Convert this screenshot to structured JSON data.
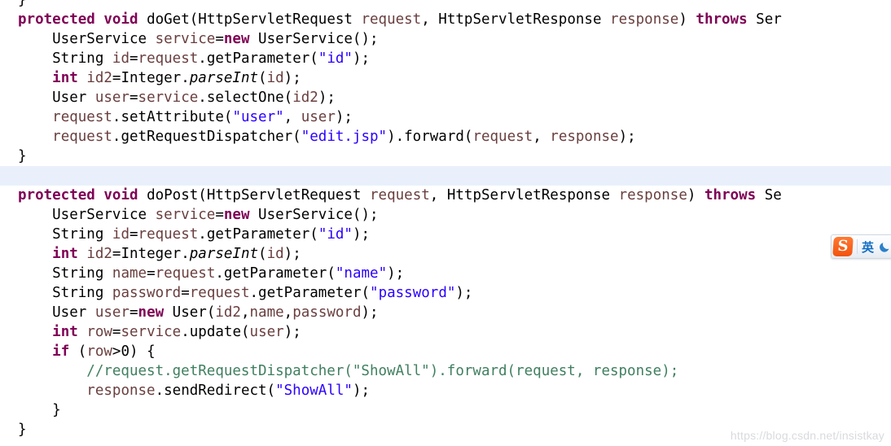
{
  "editor": {
    "language": "java",
    "background_color": "#ffffff",
    "highlight_line_color": "#e9f0fb",
    "colors": {
      "keyword": "#7f0055",
      "string": "#2a00ff",
      "comment": "#3f7f5f",
      "variable": "#6a3e3e",
      "plain": "#000000"
    },
    "lines": [
      {
        "index": 0,
        "highlighted": false,
        "tokens": [
          {
            "t": "}",
            "c": "plain",
            "indent": 4
          }
        ]
      },
      {
        "index": 1,
        "highlighted": false,
        "tokens": [
          {
            "t": "protected",
            "c": "keyword"
          },
          {
            "t": " ",
            "c": "plain"
          },
          {
            "t": "void",
            "c": "keyword"
          },
          {
            "t": " doGet(HttpServletRequest ",
            "c": "plain"
          },
          {
            "t": "request",
            "c": "var"
          },
          {
            "t": ", HttpServletResponse ",
            "c": "plain"
          },
          {
            "t": "response",
            "c": "var"
          },
          {
            "t": ") ",
            "c": "plain"
          },
          {
            "t": "throws",
            "c": "keyword"
          },
          {
            "t": " Ser",
            "c": "plain"
          }
        ]
      },
      {
        "index": 2,
        "highlighted": false,
        "tokens": [
          {
            "t": "    UserService ",
            "c": "plain"
          },
          {
            "t": "service",
            "c": "var"
          },
          {
            "t": "=",
            "c": "plain"
          },
          {
            "t": "new",
            "c": "keyword"
          },
          {
            "t": " UserService();",
            "c": "plain"
          }
        ]
      },
      {
        "index": 3,
        "highlighted": false,
        "tokens": [
          {
            "t": "    String ",
            "c": "plain"
          },
          {
            "t": "id",
            "c": "var"
          },
          {
            "t": "=",
            "c": "plain"
          },
          {
            "t": "request",
            "c": "var"
          },
          {
            "t": ".getParameter(",
            "c": "plain"
          },
          {
            "t": "\"id\"",
            "c": "string"
          },
          {
            "t": ");",
            "c": "plain"
          }
        ]
      },
      {
        "index": 4,
        "highlighted": false,
        "tokens": [
          {
            "t": "    ",
            "c": "plain"
          },
          {
            "t": "int",
            "c": "keyword"
          },
          {
            "t": " ",
            "c": "plain"
          },
          {
            "t": "id2",
            "c": "var"
          },
          {
            "t": "=Integer.",
            "c": "plain"
          },
          {
            "t": "parseInt",
            "c": "static"
          },
          {
            "t": "(",
            "c": "plain"
          },
          {
            "t": "id",
            "c": "var"
          },
          {
            "t": ");",
            "c": "plain"
          }
        ]
      },
      {
        "index": 5,
        "highlighted": false,
        "tokens": [
          {
            "t": "    User ",
            "c": "plain"
          },
          {
            "t": "user",
            "c": "var"
          },
          {
            "t": "=",
            "c": "plain"
          },
          {
            "t": "service",
            "c": "var"
          },
          {
            "t": ".selectOne(",
            "c": "plain"
          },
          {
            "t": "id2",
            "c": "var"
          },
          {
            "t": ");",
            "c": "plain"
          }
        ]
      },
      {
        "index": 6,
        "highlighted": false,
        "tokens": [
          {
            "t": "    ",
            "c": "plain"
          },
          {
            "t": "request",
            "c": "var"
          },
          {
            "t": ".setAttribute(",
            "c": "plain"
          },
          {
            "t": "\"user\"",
            "c": "string"
          },
          {
            "t": ", ",
            "c": "plain"
          },
          {
            "t": "user",
            "c": "var"
          },
          {
            "t": ");",
            "c": "plain"
          }
        ]
      },
      {
        "index": 7,
        "highlighted": false,
        "tokens": [
          {
            "t": "    ",
            "c": "plain"
          },
          {
            "t": "request",
            "c": "var"
          },
          {
            "t": ".getRequestDispatcher(",
            "c": "plain"
          },
          {
            "t": "\"edit.jsp\"",
            "c": "string"
          },
          {
            "t": ").forward(",
            "c": "plain"
          },
          {
            "t": "request",
            "c": "var"
          },
          {
            "t": ", ",
            "c": "plain"
          },
          {
            "t": "response",
            "c": "var"
          },
          {
            "t": ");",
            "c": "plain"
          }
        ]
      },
      {
        "index": 8,
        "highlighted": false,
        "tokens": [
          {
            "t": "}",
            "c": "plain",
            "indent": 2
          }
        ]
      },
      {
        "index": 9,
        "highlighted": true,
        "tokens": []
      },
      {
        "index": 10,
        "highlighted": false,
        "tokens": [
          {
            "t": "protected",
            "c": "keyword"
          },
          {
            "t": " ",
            "c": "plain"
          },
          {
            "t": "void",
            "c": "keyword"
          },
          {
            "t": " doPost(HttpServletRequest ",
            "c": "plain"
          },
          {
            "t": "request",
            "c": "var"
          },
          {
            "t": ", HttpServletResponse ",
            "c": "plain"
          },
          {
            "t": "response",
            "c": "var"
          },
          {
            "t": ") ",
            "c": "plain"
          },
          {
            "t": "throws",
            "c": "keyword"
          },
          {
            "t": " Se",
            "c": "plain"
          }
        ]
      },
      {
        "index": 11,
        "highlighted": false,
        "tokens": [
          {
            "t": "    UserService ",
            "c": "plain"
          },
          {
            "t": "service",
            "c": "var"
          },
          {
            "t": "=",
            "c": "plain"
          },
          {
            "t": "new",
            "c": "keyword"
          },
          {
            "t": " UserService();",
            "c": "plain"
          }
        ]
      },
      {
        "index": 12,
        "highlighted": false,
        "tokens": [
          {
            "t": "    String ",
            "c": "plain"
          },
          {
            "t": "id",
            "c": "var"
          },
          {
            "t": "=",
            "c": "plain"
          },
          {
            "t": "request",
            "c": "var"
          },
          {
            "t": ".getParameter(",
            "c": "plain"
          },
          {
            "t": "\"id\"",
            "c": "string"
          },
          {
            "t": ");",
            "c": "plain"
          }
        ]
      },
      {
        "index": 13,
        "highlighted": false,
        "tokens": [
          {
            "t": "    ",
            "c": "plain"
          },
          {
            "t": "int",
            "c": "keyword"
          },
          {
            "t": " ",
            "c": "plain"
          },
          {
            "t": "id2",
            "c": "var"
          },
          {
            "t": "=Integer.",
            "c": "plain"
          },
          {
            "t": "parseInt",
            "c": "static"
          },
          {
            "t": "(",
            "c": "plain"
          },
          {
            "t": "id",
            "c": "var"
          },
          {
            "t": ");",
            "c": "plain"
          }
        ]
      },
      {
        "index": 14,
        "highlighted": false,
        "tokens": [
          {
            "t": "    String ",
            "c": "plain"
          },
          {
            "t": "name",
            "c": "var"
          },
          {
            "t": "=",
            "c": "plain"
          },
          {
            "t": "request",
            "c": "var"
          },
          {
            "t": ".getParameter(",
            "c": "plain"
          },
          {
            "t": "\"name\"",
            "c": "string"
          },
          {
            "t": ");",
            "c": "plain"
          }
        ]
      },
      {
        "index": 15,
        "highlighted": false,
        "tokens": [
          {
            "t": "    String ",
            "c": "plain"
          },
          {
            "t": "password",
            "c": "var"
          },
          {
            "t": "=",
            "c": "plain"
          },
          {
            "t": "request",
            "c": "var"
          },
          {
            "t": ".getParameter(",
            "c": "plain"
          },
          {
            "t": "\"password\"",
            "c": "string"
          },
          {
            "t": ");",
            "c": "plain"
          }
        ]
      },
      {
        "index": 16,
        "highlighted": false,
        "tokens": [
          {
            "t": "    User ",
            "c": "plain"
          },
          {
            "t": "user",
            "c": "var"
          },
          {
            "t": "=",
            "c": "plain"
          },
          {
            "t": "new",
            "c": "keyword"
          },
          {
            "t": " User(",
            "c": "plain"
          },
          {
            "t": "id2",
            "c": "var"
          },
          {
            "t": ",",
            "c": "plain"
          },
          {
            "t": "name",
            "c": "var"
          },
          {
            "t": ",",
            "c": "plain"
          },
          {
            "t": "password",
            "c": "var"
          },
          {
            "t": ");",
            "c": "plain"
          }
        ]
      },
      {
        "index": 17,
        "highlighted": false,
        "tokens": [
          {
            "t": "    ",
            "c": "plain"
          },
          {
            "t": "int",
            "c": "keyword"
          },
          {
            "t": " ",
            "c": "plain"
          },
          {
            "t": "row",
            "c": "var"
          },
          {
            "t": "=",
            "c": "plain"
          },
          {
            "t": "service",
            "c": "var"
          },
          {
            "t": ".update(",
            "c": "plain"
          },
          {
            "t": "user",
            "c": "var"
          },
          {
            "t": ");",
            "c": "plain"
          }
        ]
      },
      {
        "index": 18,
        "highlighted": false,
        "tokens": [
          {
            "t": "    ",
            "c": "plain"
          },
          {
            "t": "if",
            "c": "keyword"
          },
          {
            "t": " (",
            "c": "plain"
          },
          {
            "t": "row",
            "c": "var"
          },
          {
            "t": ">0) {",
            "c": "plain"
          }
        ]
      },
      {
        "index": 19,
        "highlighted": false,
        "tokens": [
          {
            "t": "        //request.getRequestDispatcher(\"ShowAll\").forward(request, response);",
            "c": "comment"
          }
        ]
      },
      {
        "index": 20,
        "highlighted": false,
        "tokens": [
          {
            "t": "        ",
            "c": "plain"
          },
          {
            "t": "response",
            "c": "var"
          },
          {
            "t": ".sendRedirect(",
            "c": "plain"
          },
          {
            "t": "\"ShowAll\"",
            "c": "string"
          },
          {
            "t": ");",
            "c": "plain"
          }
        ]
      },
      {
        "index": 21,
        "highlighted": false,
        "tokens": [
          {
            "t": "    }",
            "c": "plain"
          }
        ]
      },
      {
        "index": 22,
        "highlighted": false,
        "tokens": [
          {
            "t": "}",
            "c": "plain",
            "indent": 2
          }
        ]
      }
    ]
  },
  "watermark": {
    "text": "https://blog.csdn.net/insistkay"
  },
  "ime_bar": {
    "logo_label": "S",
    "logo_color": "#f2520d",
    "language_label": "英",
    "language_color": "#1570c4",
    "moon_icon": "moon-icon",
    "moon_color": "#2b7fc9"
  }
}
